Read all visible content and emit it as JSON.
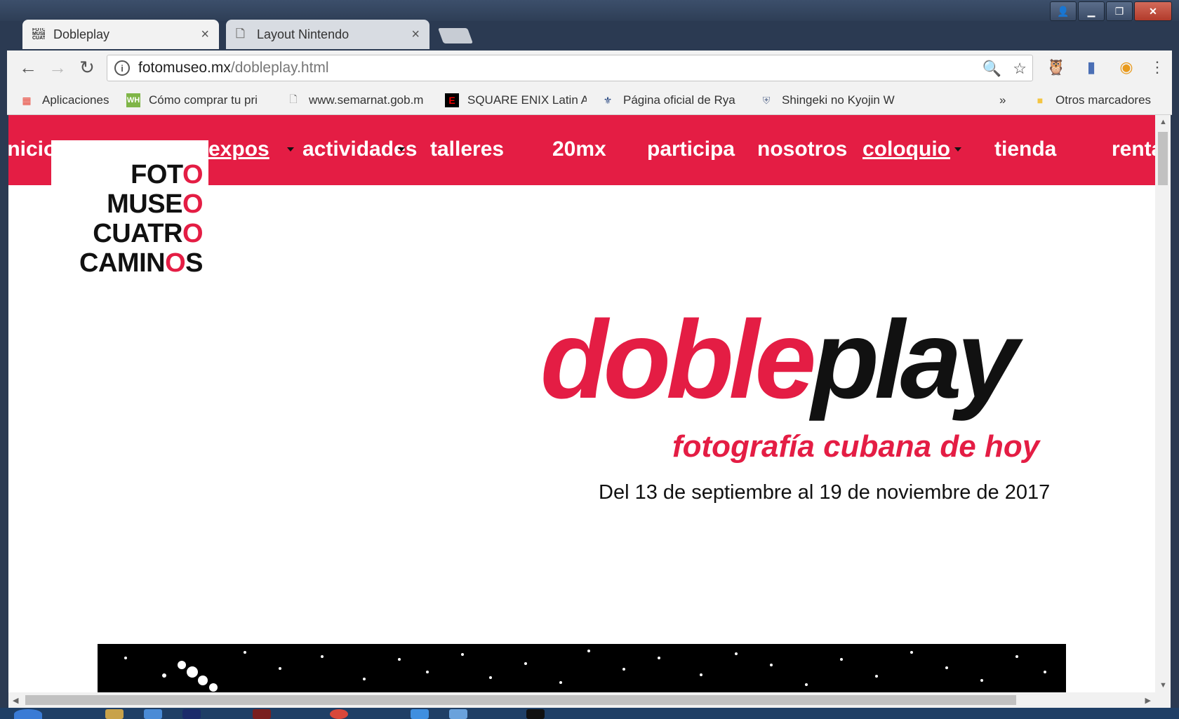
{
  "browser": {
    "tabs": [
      {
        "title": "Dobleplay",
        "active": true
      },
      {
        "title": "Layout Nintendo",
        "active": false
      }
    ],
    "url_host": "fotomuseo.mx",
    "url_path": "/dobleplay.html",
    "bookmarks": [
      {
        "label": "Aplicaciones",
        "icon": "apps-grid-icon"
      },
      {
        "label": "Cómo comprar tu pri",
        "icon": "wh-icon"
      },
      {
        "label": "www.semarnat.gob.m",
        "icon": "page-icon"
      },
      {
        "label": "SQUARE ENIX Latin A",
        "icon": "square-enix-icon"
      },
      {
        "label": "Página oficial de Rya",
        "icon": "ryanair-icon"
      },
      {
        "label": "Shingeki no Kyojin W",
        "icon": "shield-icon"
      }
    ],
    "bookmarks_overflow": "»",
    "other_bookmarks": "Otros marcadores"
  },
  "site": {
    "nav": [
      {
        "label": "inicio"
      },
      {
        "label": "expos"
      },
      {
        "label": "actividades"
      },
      {
        "label": "talleres"
      },
      {
        "label": "20mx"
      },
      {
        "label": "participa"
      },
      {
        "label": "nosotros"
      },
      {
        "label": "coloquio"
      },
      {
        "label": "tienda"
      },
      {
        "label": "renta"
      }
    ],
    "logo_lines": [
      {
        "text": "FOT",
        "o": "O"
      },
      {
        "text": "MUSE",
        "o": "O"
      },
      {
        "text": "CUATR",
        "o": "O"
      },
      {
        "text": "CAMIN",
        "o": "O",
        "tail": "S"
      }
    ],
    "hero": {
      "title_red": "doble",
      "title_black": "play",
      "subtitle": "fotografía cubana de hoy",
      "dates": "Del 13 de septiembre al 19 de noviembre de 2017"
    }
  },
  "colors": {
    "brand_red": "#e41d44",
    "nav_text": "#ffffff",
    "text": "#111111"
  }
}
